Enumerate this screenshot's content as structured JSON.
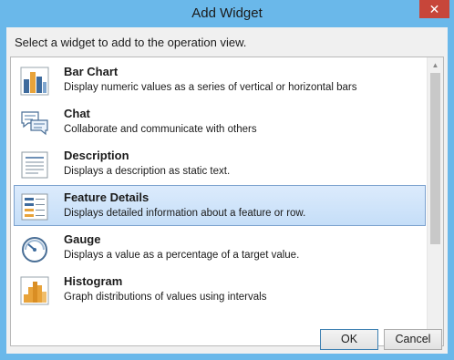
{
  "window": {
    "title": "Add Widget",
    "close_glyph": "✕"
  },
  "prompt": "Select a widget to add to the operation view.",
  "widgets": [
    {
      "title": "Bar Chart",
      "description": "Display numeric values as a series of vertical or horizontal bars",
      "icon": "bar-chart-icon"
    },
    {
      "title": "Chat",
      "description": "Collaborate and communicate with others",
      "icon": "chat-icon"
    },
    {
      "title": "Description",
      "description": "Displays a description as static text.",
      "icon": "description-icon"
    },
    {
      "title": "Feature Details",
      "description": "Displays detailed information about a feature or row.",
      "icon": "feature-details-icon",
      "selected": true
    },
    {
      "title": "Gauge",
      "description": "Displays a value as a percentage of a target value.",
      "icon": "gauge-icon"
    },
    {
      "title": "Histogram",
      "description": "Graph distributions of values using intervals",
      "icon": "histogram-icon"
    }
  ],
  "scrollbar": {
    "up_glyph": "▲",
    "down_glyph": "▼"
  },
  "buttons": {
    "ok": "OK",
    "cancel": "Cancel"
  },
  "colors": {
    "titlebar": "#6ab8ea",
    "close": "#c7463a",
    "selection": "#cde3fa",
    "accent_orange": "#e8a33a",
    "accent_blue": "#3e6b9d"
  }
}
